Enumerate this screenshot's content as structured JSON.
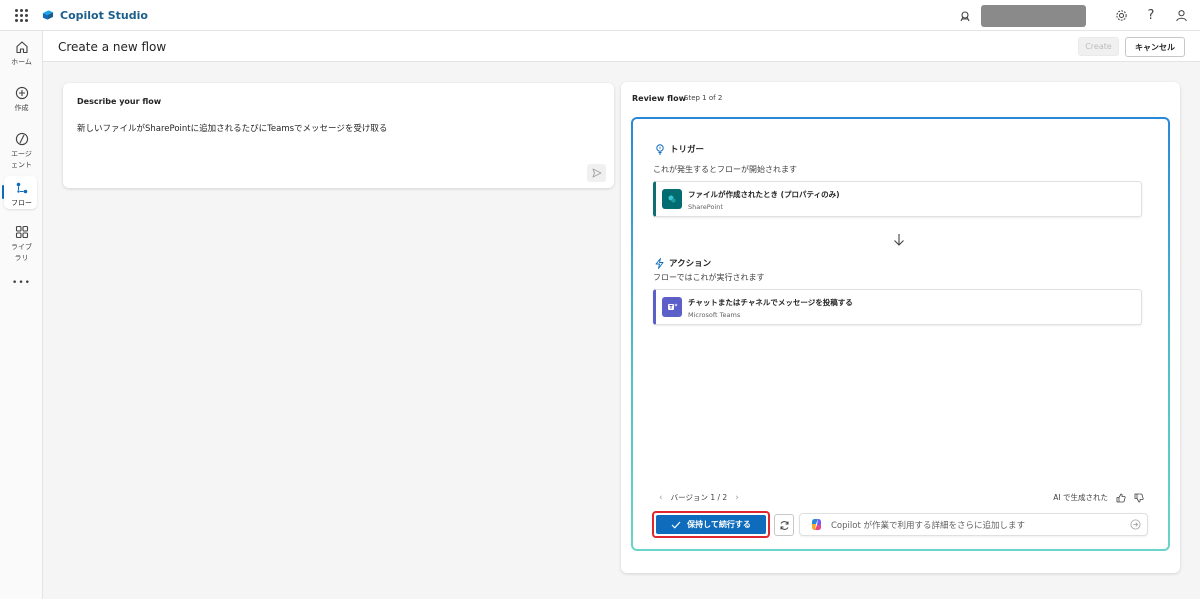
{
  "app": {
    "name": "Copilot Studio",
    "brand_color": "#1b5e8c"
  },
  "topbar": {
    "icons": [
      "waffle-icon",
      "environment-icon",
      "settings-icon",
      "help-icon",
      "account-icon"
    ],
    "help_glyph": "?"
  },
  "rail": {
    "items": [
      {
        "id": "home",
        "label": "ホーム",
        "icon": "home-icon"
      },
      {
        "id": "create",
        "label": "作成",
        "icon": "plus-circle-icon"
      },
      {
        "id": "agents",
        "label": "エージェント",
        "icon": "agent-icon"
      },
      {
        "id": "flows",
        "label": "フロー",
        "icon": "flow-icon",
        "active": true
      },
      {
        "id": "library",
        "label": "ライブラリ",
        "icon": "library-icon"
      },
      {
        "id": "more",
        "label": "...",
        "icon": "more-icon"
      }
    ],
    "labels": {
      "home": "ホーム",
      "create": "作成",
      "agents_1": "エージ",
      "agents_2": "ェント",
      "flows": "フロー",
      "library_1": "ライブ",
      "library_2": "ラリ",
      "more": "•••"
    }
  },
  "header": {
    "title": "Create a new flow",
    "create_label": "Create",
    "cancel_label": "キャンセル"
  },
  "describe": {
    "title": "Describe your flow",
    "text": "新しいファイルがSharePointに追加されるたびにTeamsでメッセージを受け取る"
  },
  "review": {
    "title": "Review flow",
    "step": "Step 1 of 2",
    "trigger": {
      "heading": "トリガー",
      "subtitle": "これが発生するとフローが開始されます",
      "card_title": "ファイルが作成されたとき (プロパティのみ)",
      "card_connector": "SharePoint",
      "connector_color": "#036c70"
    },
    "action": {
      "heading": "アクション",
      "subtitle": "フローではこれが実行されます",
      "card_title": "チャットまたはチャネルでメッセージを投稿する",
      "card_connector": "Microsoft Teams",
      "connector_color": "#5b5fc7"
    },
    "version": "バージョン 1 / 2",
    "ai_generated": "AI で生成された",
    "keep_button": "保持して続行する",
    "copilot_placeholder": "Copilot が作業で利用する詳細をさらに追加します"
  }
}
